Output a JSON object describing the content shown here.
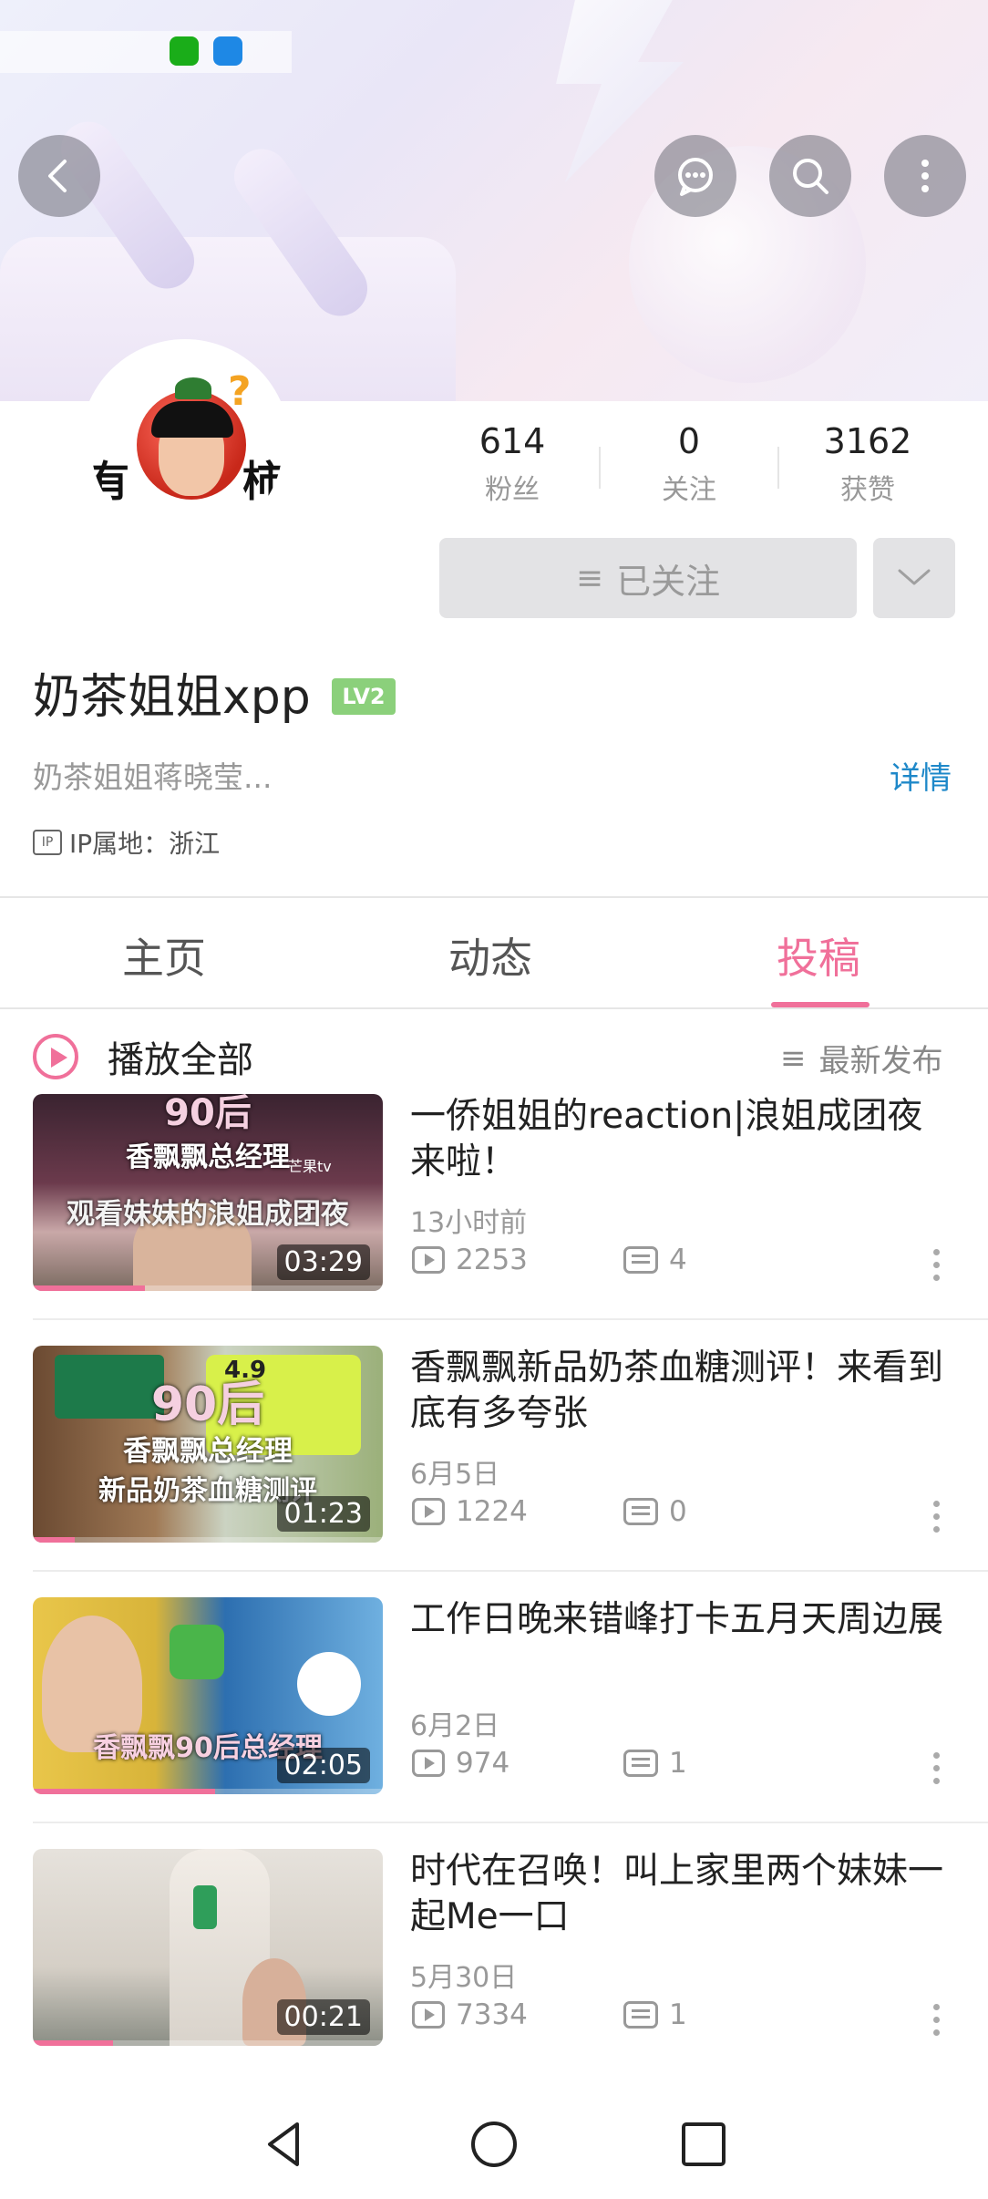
{
  "header": {
    "icons": [
      "wechat-icon",
      "shield-icon"
    ],
    "back": "back-icon",
    "actions": [
      "message-icon",
      "search-icon",
      "more-icon"
    ]
  },
  "profile": {
    "avatar_text_left": "有",
    "avatar_text_right": "柿",
    "avatar_mark": "?",
    "stats": [
      {
        "num": "614",
        "label": "粉丝"
      },
      {
        "num": "0",
        "label": "关注"
      },
      {
        "num": "3162",
        "label": "获赞"
      }
    ],
    "follow_label": "已关注",
    "username": "奶茶姐姐xpp",
    "level": "LV2",
    "bio": "奶茶姐姐蒋晓莹...",
    "detail_link": "详情",
    "ip_badge": "IP",
    "ip": "IP属地：浙江"
  },
  "tabs": [
    "主页",
    "动态",
    "投稿"
  ],
  "active_tab": "投稿",
  "list_header": {
    "play_all": "播放全部",
    "sort": "最新发布"
  },
  "videos": [
    {
      "title": "一侨姐姐的reaction|浪姐成团夜来啦！",
      "date": "13小时前",
      "views": "2253",
      "comments": "4",
      "duration": "03:29",
      "thumb_top": "90后",
      "thumb_mid": "香飘飘总经理",
      "thumb_bottom": "观看妹妹的浪姐成团夜",
      "thumb_logo": "芒果tv",
      "progress": 0.32
    },
    {
      "title": "香飘飘新品奶茶血糖测评！来看到底有多夸张",
      "date": "6月5日",
      "views": "1224",
      "comments": "0",
      "duration": "01:23",
      "thumb_top": "90后",
      "thumb_mid": "香飘飘总经理",
      "thumb_bottom": "新品奶茶血糖测评",
      "thumb_logo": "4.9",
      "progress": 0.12
    },
    {
      "title": "工作日晚来错峰打卡五月天周边展",
      "date": "6月2日",
      "views": "974",
      "comments": "1",
      "duration": "02:05",
      "thumb_top": "",
      "thumb_mid": "",
      "thumb_bottom": "香飘飘90后总经理",
      "thumb_logo": "",
      "progress": 0.52
    },
    {
      "title": "时代在召唤！叫上家里两个妹妹一起Me一口",
      "date": "5月30日",
      "views": "7334",
      "comments": "1",
      "duration": "00:21",
      "thumb_top": "",
      "thumb_mid": "",
      "thumb_bottom": "",
      "thumb_logo": "",
      "progress": 0.23
    }
  ],
  "colors": {
    "accent": "#f0709a",
    "link": "#1e88c9",
    "level": "#8bd07b"
  },
  "navbar": [
    "nav-back-icon",
    "nav-home-icon",
    "nav-recent-icon"
  ]
}
